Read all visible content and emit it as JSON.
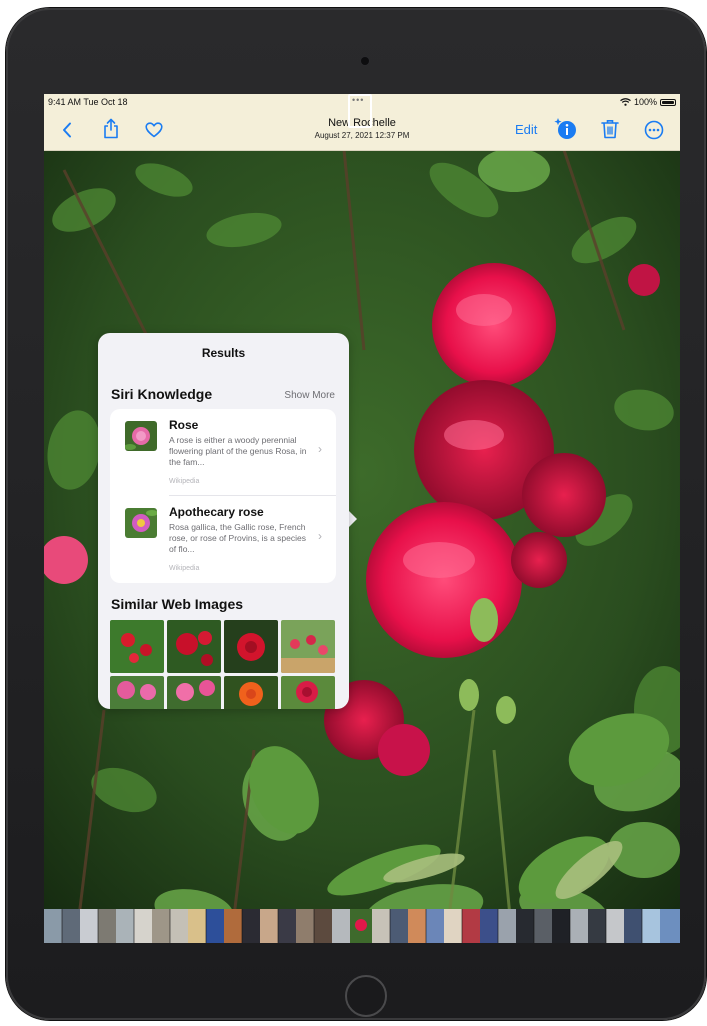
{
  "status_bar": {
    "time": "9:41 AM  Tue Oct 18",
    "dots": "•••",
    "wifi_icon": "wifi-icon",
    "battery": "100%"
  },
  "nav": {
    "title": "New Rochelle",
    "subtitle": "August 27, 2021  12:37 PM",
    "edit_label": "Edit",
    "accent_color": "#1a7cf2",
    "icons": [
      "chevron-left-icon",
      "share-icon",
      "heart-icon",
      "info-sparkle-icon",
      "trash-icon",
      "more-icon"
    ]
  },
  "results": {
    "title": "Results",
    "siri_knowledge": {
      "heading": "Siri Knowledge",
      "show_more": "Show More",
      "items": [
        {
          "title": "Rose",
          "description": "A rose is either a woody perennial flowering plant of the genus Rosa, in the fam...",
          "source": "Wikipedia"
        },
        {
          "title": "Apothecary rose",
          "description": "Rosa gallica, the Gallic rose, French rose, or rose of Provins, is a species of flo...",
          "source": "Wikipedia"
        }
      ]
    },
    "similar_web_images": {
      "heading": "Similar Web Images"
    }
  }
}
